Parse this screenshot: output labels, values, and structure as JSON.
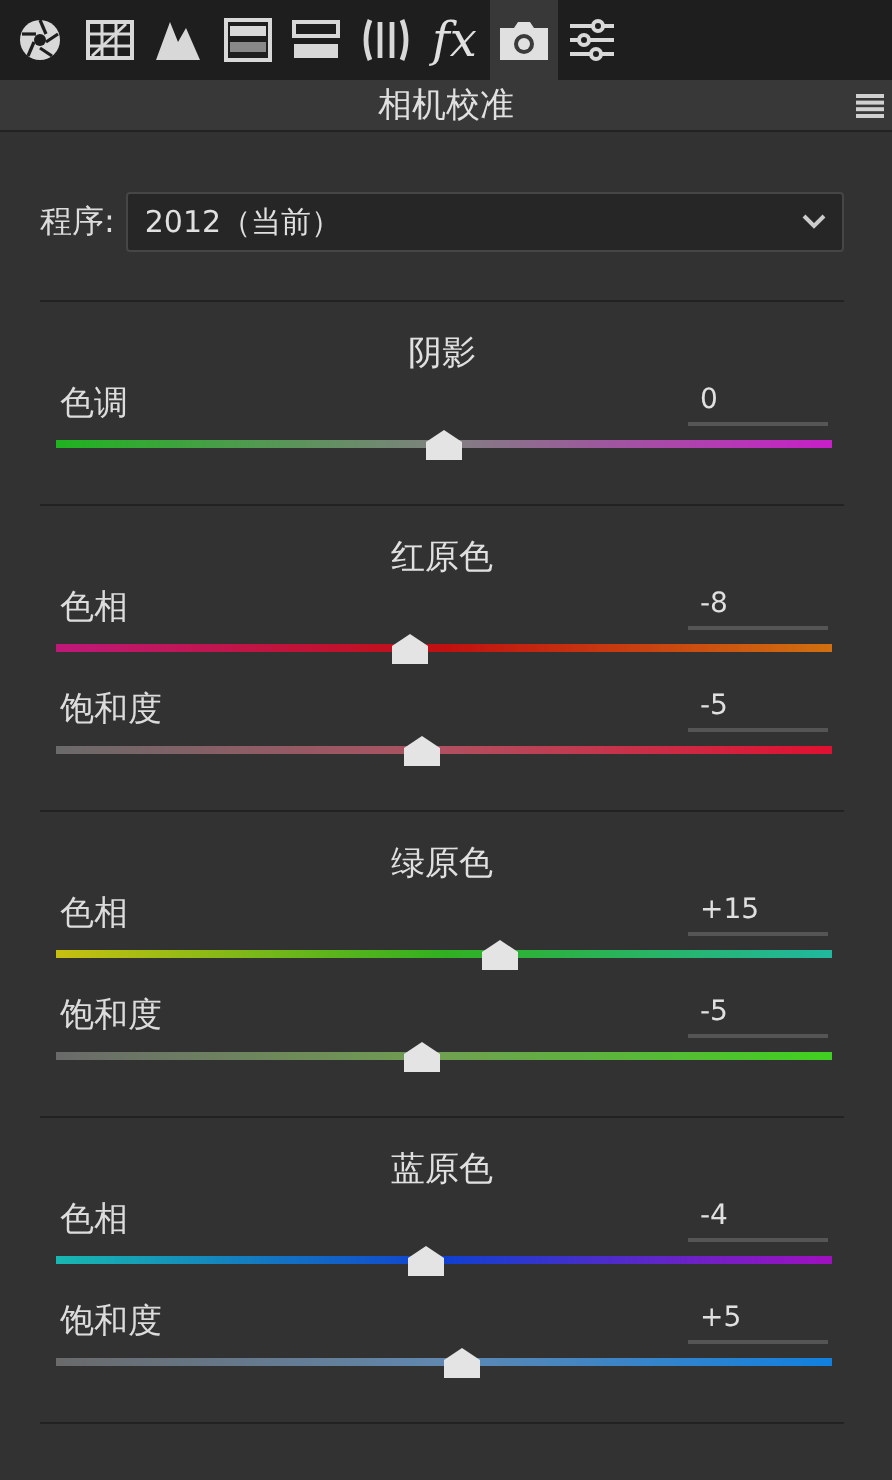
{
  "tabs": [
    {
      "kind": "aperture",
      "selected": false
    },
    {
      "kind": "grid",
      "selected": false
    },
    {
      "kind": "mountains",
      "selected": false
    },
    {
      "kind": "bars",
      "selected": false
    },
    {
      "kind": "split",
      "selected": false
    },
    {
      "kind": "lens",
      "selected": false
    },
    {
      "kind": "text",
      "label": "fx",
      "selected": false
    },
    {
      "kind": "camera",
      "selected": true
    },
    {
      "kind": "sliders",
      "selected": false
    }
  ],
  "panel": {
    "title": "相机校准"
  },
  "process": {
    "label": "程序:",
    "value": "2012（当前）"
  },
  "sections": [
    {
      "kind": "shadows",
      "title": "阴影",
      "sliders": [
        {
          "kind": "tint",
          "label": "色调",
          "reading": "0",
          "level": 0.5
        }
      ]
    },
    {
      "kind": "red",
      "title": "红原色",
      "sliders": [
        {
          "kind": "hue",
          "label": "色相",
          "reading": "-8",
          "level": 0.456
        },
        {
          "kind": "saturation",
          "label": "饱和度",
          "reading": "-5",
          "level": 0.471
        }
      ]
    },
    {
      "kind": "green",
      "title": "绿原色",
      "sliders": [
        {
          "kind": "hue",
          "label": "色相",
          "reading": "+15",
          "level": 0.573
        },
        {
          "kind": "saturation",
          "label": "饱和度",
          "reading": "-5",
          "level": 0.471
        }
      ]
    },
    {
      "kind": "blue",
      "title": "蓝原色",
      "sliders": [
        {
          "kind": "hue",
          "label": "色相",
          "reading": "-4",
          "level": 0.477
        },
        {
          "kind": "saturation",
          "label": "饱和度",
          "reading": "+5",
          "level": 0.523
        }
      ]
    }
  ]
}
